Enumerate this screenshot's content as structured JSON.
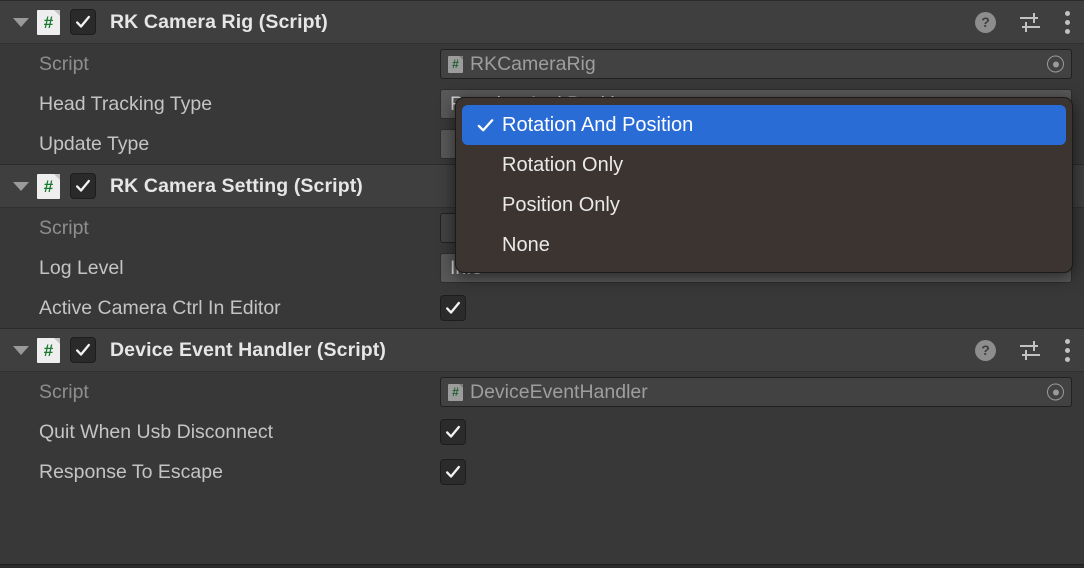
{
  "components": [
    {
      "title": "RK Camera Rig (Script)",
      "enabled": true,
      "foldout_expanded": true,
      "script_icon": "csharp-script-icon",
      "header_icons": [
        "help-icon",
        "preset-icon",
        "kebab-menu-icon"
      ],
      "properties": [
        {
          "label": "Script",
          "type": "object",
          "value": "RKCameraRig",
          "dimmed": true
        },
        {
          "label": "Head Tracking Type",
          "type": "enum",
          "value": "Rotation And Position"
        },
        {
          "label": "Update Type",
          "type": "enum",
          "value": ""
        }
      ]
    },
    {
      "title": "RK Camera Setting (Script)",
      "enabled": true,
      "foldout_expanded": true,
      "script_icon": "csharp-script-icon",
      "header_icons": [
        "help-icon",
        "preset-icon",
        "kebab-menu-icon"
      ],
      "properties": [
        {
          "label": "Script",
          "type": "object",
          "value": "",
          "dimmed": true
        },
        {
          "label": "Log Level",
          "type": "enum",
          "value": "Info"
        },
        {
          "label": "Active Camera Ctrl In Editor",
          "type": "checkbox",
          "checked": true
        }
      ]
    },
    {
      "title": "Device Event Handler (Script)",
      "enabled": true,
      "foldout_expanded": true,
      "script_icon": "csharp-script-icon",
      "header_icons": [
        "help-icon",
        "preset-icon",
        "kebab-menu-icon"
      ],
      "properties": [
        {
          "label": "Script",
          "type": "object",
          "value": "DeviceEventHandler",
          "dimmed": true
        },
        {
          "label": "Quit When Usb Disconnect",
          "type": "checkbox",
          "checked": true
        },
        {
          "label": "Response To Escape",
          "type": "checkbox",
          "checked": true
        }
      ]
    }
  ],
  "dropdown": {
    "open": true,
    "owner_property": "Head Tracking Type",
    "selected": "Rotation And Position",
    "items": [
      {
        "label": "Rotation And Position",
        "selected": true
      },
      {
        "label": "Rotation Only",
        "selected": false
      },
      {
        "label": "Position Only",
        "selected": false
      },
      {
        "label": "None",
        "selected": false
      }
    ]
  },
  "icons": {
    "help_glyph": "?",
    "csharp_glyph": "#",
    "check_glyph": "check-mark"
  },
  "colors": {
    "background": "#383838",
    "header": "#3f3f3f",
    "accent_selection": "#2a6cd6",
    "dropdown_bg": "#3b3431",
    "label_text": "#c4c4c4",
    "dim_text": "#8e8e8e",
    "csharp_green": "#1a7a31"
  }
}
